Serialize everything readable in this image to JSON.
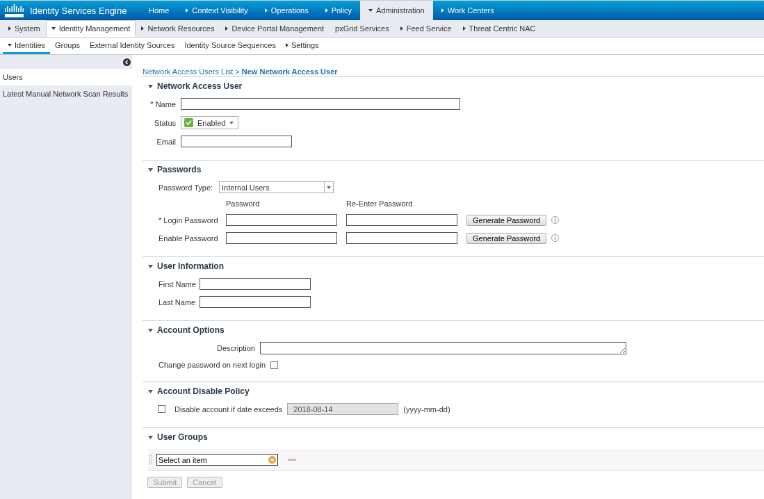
{
  "header": {
    "product": "Identity Services Engine",
    "tabs": [
      {
        "label": "Home",
        "menu": false,
        "selected": false
      },
      {
        "label": "Context Visibility",
        "menu": true,
        "selected": false
      },
      {
        "label": "Operations",
        "menu": true,
        "selected": false
      },
      {
        "label": "Policy",
        "menu": true,
        "selected": false
      },
      {
        "label": "Administration",
        "menu": true,
        "selected": true
      },
      {
        "label": "Work Centers",
        "menu": true,
        "selected": false
      }
    ]
  },
  "subtabs": [
    {
      "label": "System",
      "menu": true,
      "selected": false
    },
    {
      "label": "Identity Management",
      "menu": true,
      "selected": true
    },
    {
      "label": "Network Resources",
      "menu": true,
      "selected": false
    },
    {
      "label": "Device Portal Management",
      "menu": true,
      "selected": false
    },
    {
      "label": "pxGrid Services",
      "menu": false,
      "selected": false
    },
    {
      "label": "Feed Service",
      "menu": true,
      "selected": false
    },
    {
      "label": "Threat Centric NAC",
      "menu": true,
      "selected": false
    }
  ],
  "tertiary_tabs": [
    {
      "label": "Identities",
      "menu": true,
      "selected": true
    },
    {
      "label": "Groups",
      "menu": false,
      "selected": false
    },
    {
      "label": "External Identity Sources",
      "menu": false,
      "selected": false
    },
    {
      "label": "Identity Source Sequences",
      "menu": false,
      "selected": false
    },
    {
      "label": "Settings",
      "menu": true,
      "selected": false
    }
  ],
  "sidebar": {
    "items": [
      {
        "label": "Users",
        "selected": true
      },
      {
        "label": "Latest Manual Network Scan Results",
        "selected": false
      }
    ]
  },
  "breadcrumb": {
    "parent": "Network Access Users List",
    "separator": ">",
    "current": "New Network Access User"
  },
  "network_access_user": {
    "title": "Network Access User",
    "name_label": "* Name",
    "status_label": "Status",
    "status": {
      "value": "Enabled",
      "checked": true
    },
    "email_label": "Email"
  },
  "passwords": {
    "title": "Passwords",
    "type_label": "Password Type:",
    "type_value": "Internal Users",
    "column_1": "Password",
    "column_2": "Re-Enter Password",
    "rows": [
      {
        "label": "* Login Password",
        "button": "Generate Password"
      },
      {
        "label": "Enable Password",
        "button": "Generate Password"
      }
    ]
  },
  "user_information": {
    "title": "User Information",
    "fields": [
      {
        "label": "First Name"
      },
      {
        "label": "Last Name"
      }
    ]
  },
  "account_options": {
    "title": "Account Options",
    "description_label": "Description",
    "change_password": {
      "label": "Change password on next login",
      "checked": false
    }
  },
  "account_disable_policy": {
    "title": "Account Disable Policy",
    "checked": false,
    "label": "Disable account if date exceeds",
    "date": "2018-08-14",
    "format": "(yyyy-mm-dd)"
  },
  "user_groups": {
    "title": "User Groups",
    "select": "Select an item"
  },
  "buttons": [
    {
      "label": "Submit",
      "disabled": true
    },
    {
      "label": "Cancel",
      "disabled": true
    }
  ]
}
